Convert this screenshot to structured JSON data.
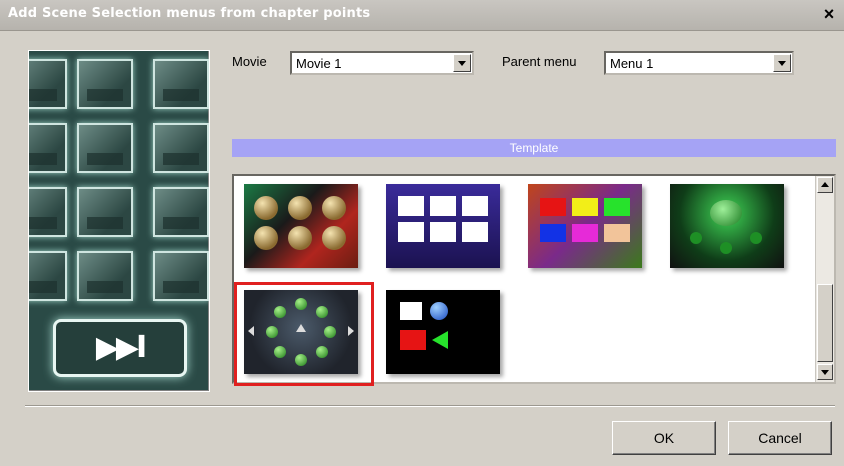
{
  "window": {
    "title": "Add Scene Selection menus from chapter points",
    "close_glyph": "×"
  },
  "preview": {
    "next_glyph": "▶▶I"
  },
  "fields": {
    "movie_label": "Movie",
    "movie_value": "Movie 1",
    "parent_menu_label": "Parent menu",
    "parent_menu_value": "Menu 1"
  },
  "gallery": {
    "header": "Template",
    "templates": [
      {
        "name": "brass-spheres-template",
        "selected": false
      },
      {
        "name": "purple-grid-template",
        "selected": false
      },
      {
        "name": "color-blocks-template",
        "selected": false
      },
      {
        "name": "green-alien-template",
        "selected": false
      },
      {
        "name": "green-orbs-circle-template",
        "selected": true
      },
      {
        "name": "black-minimal-template",
        "selected": false
      }
    ]
  },
  "buttons": {
    "ok": "OK",
    "cancel": "Cancel"
  },
  "colors": {
    "selection": "#e02020",
    "header_bg": "#a5a3f5",
    "dialog_bg": "#d4d0c8"
  }
}
